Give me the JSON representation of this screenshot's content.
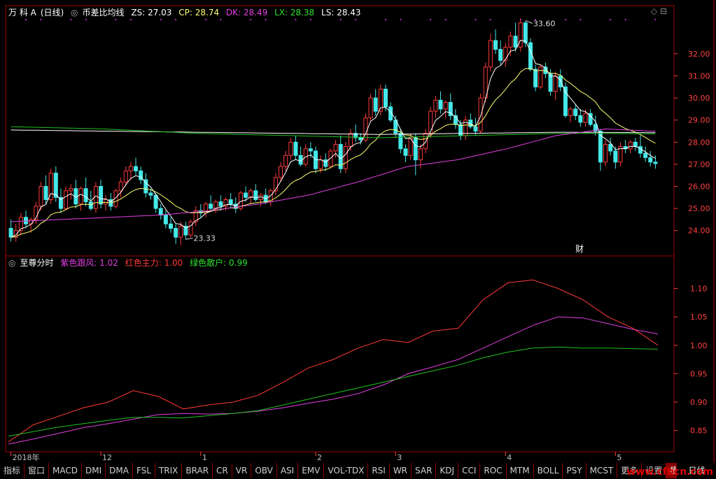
{
  "header_top": {
    "stock": "万 科 A",
    "period": "(日线)",
    "indicator": "币差比均线",
    "zs": "ZS: 27.03",
    "cp": "CP: 28.74",
    "dk": "DK: 28.49",
    "lx": "LX: 28.38",
    "ls": "LS: 28.43"
  },
  "header_bottom": {
    "indicator": "至尊分时",
    "purple": "紫色跟风: 1.02",
    "red": "红色主力: 1.00",
    "green": "绿色散户: 0.99"
  },
  "tabs": [
    "指标",
    "窗口",
    "MACD",
    "DMI",
    "DMA",
    "FSL",
    "TRIX",
    "BRAR",
    "CR",
    "VR",
    "OBV",
    "ASI",
    "EMV",
    "VOL-TDX",
    "RSI",
    "WR",
    "SAR",
    "KDJ",
    "CCI",
    "ROC",
    "MTM",
    "BOLL",
    "PSY",
    "MCST",
    "更多",
    "设置",
    "模板"
  ],
  "period_tab": "日线",
  "watermark": "www.cfbcn.com",
  "fin_marker": "财",
  "colors": {
    "up": "#ff3a3a",
    "down": "#45e8e8",
    "white": "#ffffff",
    "yellow": "#ffff70",
    "magenta": "#e040e0",
    "green": "#20c020",
    "frame": "#a00000",
    "axis": "#ff4040"
  },
  "chart_data": [
    {
      "type": "candlestick",
      "title": "币差比均线",
      "ylim": [
        23.2,
        33.8
      ],
      "yticks": [
        24.0,
        25.0,
        26.0,
        27.0,
        28.0,
        29.0,
        30.0,
        31.0,
        32.0
      ],
      "x_labels": [
        {
          "label": "2018年",
          "index": 0
        },
        {
          "label": "12",
          "index": 18
        },
        {
          "label": "1",
          "index": 38
        },
        {
          "label": "2",
          "index": 61
        },
        {
          "label": "3",
          "index": 77
        },
        {
          "label": "4",
          "index": 99
        },
        {
          "label": "5",
          "index": 121
        }
      ],
      "annotations": [
        {
          "text": "33.60",
          "index": 103
        },
        {
          "text": "23.33",
          "index": 35
        }
      ],
      "candles": [
        [
          24.1,
          24.5,
          23.5,
          23.7
        ],
        [
          23.7,
          24.3,
          23.5,
          24.0
        ],
        [
          24.0,
          24.8,
          23.8,
          24.6
        ],
        [
          24.6,
          24.9,
          24.1,
          24.3
        ],
        [
          24.3,
          24.6,
          23.9,
          24.5
        ],
        [
          24.5,
          25.3,
          24.3,
          25.1
        ],
        [
          25.1,
          26.2,
          24.9,
          26.0
        ],
        [
          26.0,
          26.5,
          25.2,
          25.4
        ],
        [
          25.4,
          26.8,
          25.2,
          26.6
        ],
        [
          26.6,
          26.9,
          25.3,
          25.5
        ],
        [
          25.5,
          25.9,
          24.8,
          25.0
        ],
        [
          25.0,
          26.0,
          24.9,
          25.8
        ],
        [
          25.8,
          26.1,
          25.4,
          25.9
        ],
        [
          25.9,
          26.3,
          25.0,
          25.2
        ],
        [
          25.2,
          26.0,
          24.9,
          25.9
        ],
        [
          25.9,
          26.4,
          25.1,
          25.3
        ],
        [
          25.3,
          25.8,
          24.9,
          25.0
        ],
        [
          25.0,
          26.2,
          24.8,
          26.0
        ],
        [
          26.0,
          26.3,
          25.0,
          25.2
        ],
        [
          25.2,
          25.6,
          24.9,
          25.4
        ],
        [
          25.4,
          25.7,
          24.9,
          25.1
        ],
        [
          25.1,
          25.9,
          25.0,
          25.8
        ],
        [
          25.8,
          26.4,
          25.5,
          26.2
        ],
        [
          26.2,
          26.9,
          26.0,
          26.7
        ],
        [
          26.7,
          27.1,
          26.3,
          26.9
        ],
        [
          26.9,
          27.3,
          26.5,
          26.7
        ],
        [
          26.7,
          26.9,
          26.1,
          26.3
        ],
        [
          26.3,
          26.6,
          25.5,
          25.7
        ],
        [
          25.7,
          25.9,
          25.4,
          25.6
        ],
        [
          25.6,
          25.7,
          24.8,
          25.0
        ],
        [
          25.0,
          25.2,
          24.5,
          24.7
        ],
        [
          24.7,
          24.9,
          24.1,
          24.3
        ],
        [
          24.3,
          24.6,
          23.9,
          24.1
        ],
        [
          24.1,
          24.3,
          23.4,
          23.7
        ],
        [
          23.7,
          24.4,
          23.33,
          24.2
        ],
        [
          24.2,
          24.4,
          23.6,
          23.8
        ],
        [
          23.8,
          24.5,
          23.7,
          24.4
        ],
        [
          24.4,
          25.1,
          24.2,
          24.9
        ],
        [
          24.9,
          25.2,
          24.6,
          24.8
        ],
        [
          24.8,
          25.3,
          24.6,
          25.2
        ],
        [
          25.2,
          25.6,
          24.9,
          25.0
        ],
        [
          25.0,
          25.4,
          24.8,
          25.3
        ],
        [
          25.3,
          25.6,
          24.9,
          25.1
        ],
        [
          25.1,
          25.5,
          24.9,
          25.4
        ],
        [
          25.4,
          25.7,
          25.0,
          25.2
        ],
        [
          25.2,
          25.5,
          24.8,
          25.0
        ],
        [
          25.0,
          25.8,
          24.9,
          25.7
        ],
        [
          25.7,
          26.0,
          25.3,
          25.5
        ],
        [
          25.5,
          25.9,
          25.2,
          25.8
        ],
        [
          25.8,
          26.1,
          25.3,
          25.4
        ],
        [
          25.4,
          25.7,
          25.1,
          25.6
        ],
        [
          25.6,
          25.9,
          25.2,
          25.3
        ],
        [
          25.3,
          25.9,
          25.1,
          25.8
        ],
        [
          25.8,
          26.6,
          25.6,
          26.4
        ],
        [
          26.4,
          27.1,
          26.2,
          26.9
        ],
        [
          26.9,
          27.6,
          26.7,
          27.4
        ],
        [
          27.4,
          28.2,
          27.2,
          28.0
        ],
        [
          28.0,
          28.3,
          27.2,
          27.4
        ],
        [
          27.4,
          27.8,
          26.9,
          27.0
        ],
        [
          27.0,
          27.9,
          26.9,
          27.7
        ],
        [
          27.7,
          28.0,
          27.3,
          27.6
        ],
        [
          27.6,
          27.8,
          26.6,
          26.8
        ],
        [
          26.8,
          27.4,
          26.6,
          27.2
        ],
        [
          27.2,
          27.5,
          26.7,
          26.9
        ],
        [
          26.9,
          27.7,
          26.8,
          27.6
        ],
        [
          27.6,
          28.1,
          27.3,
          27.9
        ],
        [
          27.9,
          28.3,
          26.6,
          26.8
        ],
        [
          26.8,
          28.0,
          26.6,
          27.8
        ],
        [
          27.8,
          28.6,
          27.6,
          28.4
        ],
        [
          28.4,
          28.8,
          28.0,
          28.2
        ],
        [
          28.2,
          28.4,
          27.9,
          28.1
        ],
        [
          28.1,
          29.3,
          28.0,
          29.1
        ],
        [
          29.1,
          30.2,
          28.9,
          30.0
        ],
        [
          30.0,
          30.4,
          29.2,
          29.4
        ],
        [
          29.4,
          30.6,
          29.2,
          30.4
        ],
        [
          30.4,
          30.6,
          29.4,
          29.6
        ],
        [
          29.6,
          29.8,
          28.9,
          29.0
        ],
        [
          29.0,
          29.2,
          28.2,
          28.4
        ],
        [
          28.4,
          28.6,
          27.5,
          27.7
        ],
        [
          27.7,
          27.9,
          27.1,
          27.4
        ],
        [
          27.4,
          28.4,
          27.2,
          28.2
        ],
        [
          28.2,
          28.4,
          26.5,
          27.2
        ],
        [
          27.2,
          27.9,
          26.8,
          27.7
        ],
        [
          27.7,
          28.6,
          27.5,
          28.4
        ],
        [
          28.4,
          29.6,
          28.2,
          29.4
        ],
        [
          29.4,
          30.1,
          29.1,
          29.9
        ],
        [
          29.9,
          30.3,
          29.3,
          29.5
        ],
        [
          29.5,
          29.9,
          29.1,
          29.8
        ],
        [
          29.8,
          30.2,
          29.0,
          29.2
        ],
        [
          29.2,
          29.5,
          28.6,
          28.8
        ],
        [
          28.8,
          29.0,
          28.1,
          28.3
        ],
        [
          28.3,
          29.2,
          28.1,
          29.0
        ],
        [
          29.0,
          29.3,
          28.6,
          28.7
        ],
        [
          28.7,
          29.1,
          28.3,
          28.5
        ],
        [
          28.5,
          30.2,
          28.4,
          30.0
        ],
        [
          30.0,
          31.6,
          29.8,
          31.4
        ],
        [
          31.4,
          32.9,
          31.2,
          32.6
        ],
        [
          32.6,
          33.1,
          32.0,
          32.2
        ],
        [
          32.2,
          32.6,
          31.5,
          31.7
        ],
        [
          31.7,
          32.5,
          31.4,
          32.3
        ],
        [
          32.3,
          33.0,
          31.9,
          32.8
        ],
        [
          32.8,
          33.4,
          32.1,
          32.3
        ],
        [
          32.3,
          33.6,
          32.1,
          33.4
        ],
        [
          33.4,
          33.5,
          32.3,
          32.5
        ],
        [
          32.5,
          32.7,
          31.2,
          31.3
        ],
        [
          31.3,
          31.5,
          30.3,
          30.5
        ],
        [
          30.5,
          31.5,
          30.4,
          31.4
        ],
        [
          31.4,
          31.6,
          30.9,
          31.1
        ],
        [
          31.1,
          31.3,
          30.1,
          30.3
        ],
        [
          30.3,
          31.2,
          29.9,
          31.0
        ],
        [
          31.0,
          31.3,
          30.3,
          30.5
        ],
        [
          30.5,
          30.7,
          29.1,
          29.2
        ],
        [
          29.2,
          29.6,
          28.9,
          29.5
        ],
        [
          29.5,
          29.7,
          29.0,
          29.2
        ],
        [
          29.2,
          29.5,
          28.7,
          28.9
        ],
        [
          28.9,
          29.5,
          28.7,
          29.3
        ],
        [
          29.3,
          29.5,
          28.7,
          28.8
        ],
        [
          28.8,
          29.2,
          28.3,
          28.5
        ],
        [
          28.5,
          28.6,
          26.7,
          27.1
        ],
        [
          27.1,
          28.1,
          26.9,
          27.9
        ],
        [
          27.9,
          28.2,
          27.4,
          27.6
        ],
        [
          27.6,
          27.8,
          26.8,
          27.1
        ],
        [
          27.1,
          28.0,
          26.9,
          27.8
        ],
        [
          27.8,
          28.1,
          27.5,
          27.7
        ],
        [
          27.7,
          28.1,
          27.5,
          28.0
        ],
        [
          28.0,
          28.2,
          27.6,
          27.8
        ],
        [
          27.8,
          28.3,
          27.3,
          27.5
        ],
        [
          27.5,
          27.8,
          27.1,
          27.3
        ],
        [
          27.3,
          27.6,
          26.9,
          27.1
        ],
        [
          27.1,
          27.4,
          26.8,
          27.03
        ]
      ],
      "series": [
        {
          "values": [
            27.2,
            27.1,
            27.9,
            28.7,
            29.2,
            28.8
          ]
        },
        {
          "values": [
            28.55,
            28.5,
            28.45,
            28.4,
            28.35,
            28.4,
            28.45,
            28.43
          ]
        },
        {
          "values": [
            28.7,
            28.6,
            28.4,
            28.3,
            28.2,
            28.3,
            28.4,
            28.38
          ]
        },
        {
          "values": [
            24.4,
            24.5,
            24.6,
            24.7,
            24.9,
            25.2,
            25.6,
            26.2,
            26.9,
            27.2,
            27.7,
            28.3,
            28.6,
            28.49
          ]
        }
      ]
    },
    {
      "type": "line",
      "title": "至尊分时",
      "ylim": [
        0.82,
        1.14
      ],
      "yticks": [
        0.85,
        0.9,
        0.95,
        1.0,
        1.05,
        1.1
      ],
      "series": [
        {
          "name": "紫色跟风",
          "values": [
            0.826,
            0.835,
            0.845,
            0.855,
            0.862,
            0.87,
            0.878,
            0.88,
            0.879,
            0.88,
            0.884,
            0.89,
            0.898,
            0.905,
            0.915,
            0.93,
            0.95,
            0.962,
            0.975,
            0.995,
            1.015,
            1.035,
            1.05,
            1.048,
            1.038,
            1.028,
            1.02
          ]
        },
        {
          "name": "红色主力",
          "values": [
            0.83,
            0.86,
            0.875,
            0.89,
            0.9,
            0.92,
            0.91,
            0.888,
            0.895,
            0.9,
            0.912,
            0.935,
            0.96,
            0.975,
            0.995,
            1.01,
            1.005,
            1.025,
            1.03,
            1.08,
            1.11,
            1.115,
            1.1,
            1.08,
            1.05,
            1.03,
            1.0
          ]
        },
        {
          "name": "绿色散户",
          "values": [
            0.84,
            0.848,
            0.856,
            0.862,
            0.868,
            0.873,
            0.873,
            0.872,
            0.876,
            0.88,
            0.885,
            0.895,
            0.905,
            0.915,
            0.925,
            0.935,
            0.945,
            0.955,
            0.965,
            0.978,
            0.988,
            0.995,
            0.997,
            0.995,
            0.995,
            0.994,
            0.993
          ]
        }
      ]
    }
  ]
}
